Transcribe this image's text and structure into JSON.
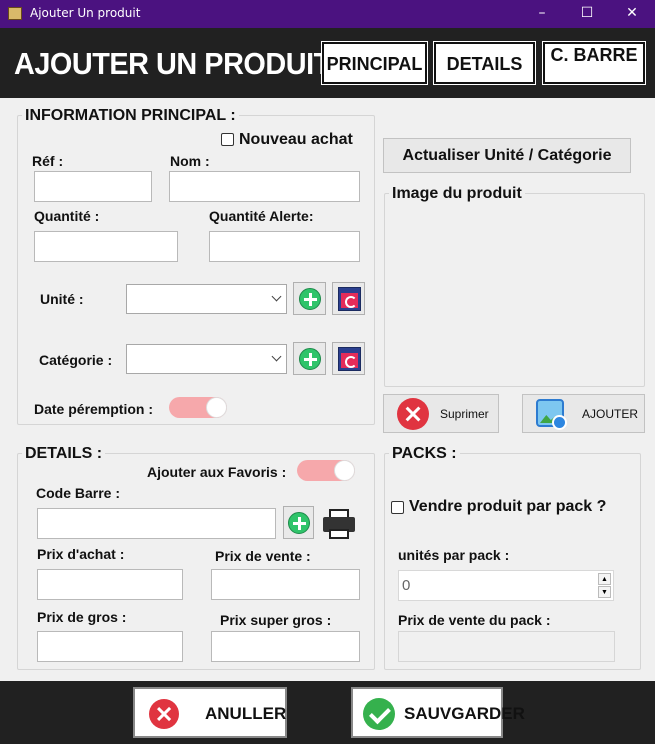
{
  "window": {
    "title": "Ajouter Un produit",
    "min_glyph": "–",
    "max_glyph": "☐",
    "close_glyph": "✕"
  },
  "header": {
    "title": "AJOUTER UN PRODUIT",
    "tabs": [
      {
        "label": "PRINCIPAL"
      },
      {
        "label": "DETAILS"
      },
      {
        "label": "C. BARRE"
      }
    ]
  },
  "info": {
    "title": "INFORMATION PRINCIPAL :",
    "nouveau_achat": {
      "label": "Nouveau achat",
      "checked": false
    },
    "ref": {
      "label": "Réf :",
      "value": ""
    },
    "nom": {
      "label": "Nom :",
      "value": ""
    },
    "quantite": {
      "label": "Quantité :",
      "value": ""
    },
    "quantite_alerte": {
      "label": "Quantité Alerte:",
      "value": ""
    },
    "unite": {
      "label": "Unité :",
      "selected": ""
    },
    "categorie": {
      "label": "Catégorie :",
      "selected": ""
    },
    "date_peremption": {
      "label": "Date péremption :",
      "enabled": false
    }
  },
  "image_panel": {
    "refresh_button": "Actualiser Unité / Catégorie",
    "title": "Image du produit",
    "delete_button": "Suprimer",
    "add_button": "AJOUTER"
  },
  "details": {
    "title": "DETAILS :",
    "favoris": {
      "label": "Ajouter aux Favoris :",
      "enabled": false
    },
    "code_barre": {
      "label": "Code Barre :",
      "value": ""
    },
    "prix_achat": {
      "label": "Prix d'achat :",
      "value": ""
    },
    "prix_vente": {
      "label": "Prix de vente :",
      "value": ""
    },
    "prix_gros": {
      "label": "Prix de gros :",
      "value": ""
    },
    "prix_super_gros": {
      "label": "Prix super gros :",
      "value": ""
    }
  },
  "packs": {
    "title": "PACKS :",
    "vendre_pack": {
      "label": "Vendre produit par pack ?",
      "checked": false
    },
    "unites_par_pack": {
      "label": "unités par pack :",
      "value": "0"
    },
    "prix_vente_pack": {
      "label": "Prix de vente du pack :",
      "value": ""
    }
  },
  "footer": {
    "cancel_button": "ANULLER",
    "save_button": "SAUVGARDER"
  },
  "colors": {
    "titlebar": "#4b1280",
    "header_bg": "#212121",
    "toggle_off": "#f6a8ab",
    "plus_green": "#2fc46a",
    "delete_red": "#e03440",
    "save_green": "#35b14d"
  }
}
